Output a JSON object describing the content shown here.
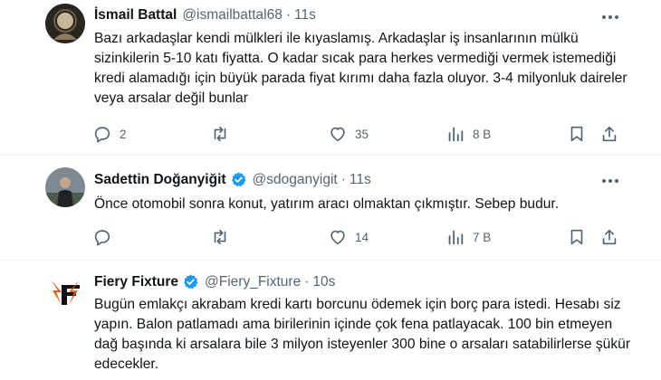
{
  "tweets": [
    {
      "name": "İsmail Battal",
      "handle": "@ismailbattal68",
      "time": "11s",
      "verified": false,
      "text": "Bazı arkadaşlar kendi mülkleri ile kıyaslamış. Arkadaşlar iş insanlarının mülkü sizinkilerin 5-10 katı fiyatta. O kadar sıcak para herkes vermediği vermek istemediği kredi alamadığı için büyük parada fiyat kırımı daha fazla oluyor. 3-4 milyonluk daireler veya arsalar değil bunlar",
      "replies": "2",
      "retweets": "",
      "likes": "35",
      "views": "8 B"
    },
    {
      "name": "Sadettin Doğanyiğit",
      "handle": "@sdoganyigit",
      "time": "11s",
      "verified": true,
      "text": "Önce otomobil sonra konut, yatırım aracı olmaktan çıkmıştır. Sebep budur.",
      "replies": "",
      "retweets": "",
      "likes": "14",
      "views": "7 B"
    },
    {
      "name": "Fiery Fixture",
      "handle": "@Fiery_Fixture",
      "time": "10s",
      "verified": true,
      "text": "Bugün emlakçı akrabam kredi kartı borcunu ödemek için borç para istedi. Hesabı siz yapın. Balon patlamadı ama birilerinin içinde çok fena patlayacak. 100 bin etmeyen dağ başında ki arsalara bile 3 milyon isteyenler 300 bine o arsaları satabilirlerse şükür edecekler."
    }
  ],
  "icons": {
    "reply": "reply-icon",
    "retweet": "retweet-icon",
    "like": "like-icon",
    "views": "views-icon",
    "bookmark": "bookmark-icon",
    "share": "share-icon",
    "more": "more-icon",
    "verified": "verified-icon"
  },
  "colors": {
    "text": "#0f1419",
    "secondary": "#536471",
    "verified": "#1d9bf0",
    "divider": "#eff3f4",
    "logo_orange": "#e8590c"
  }
}
